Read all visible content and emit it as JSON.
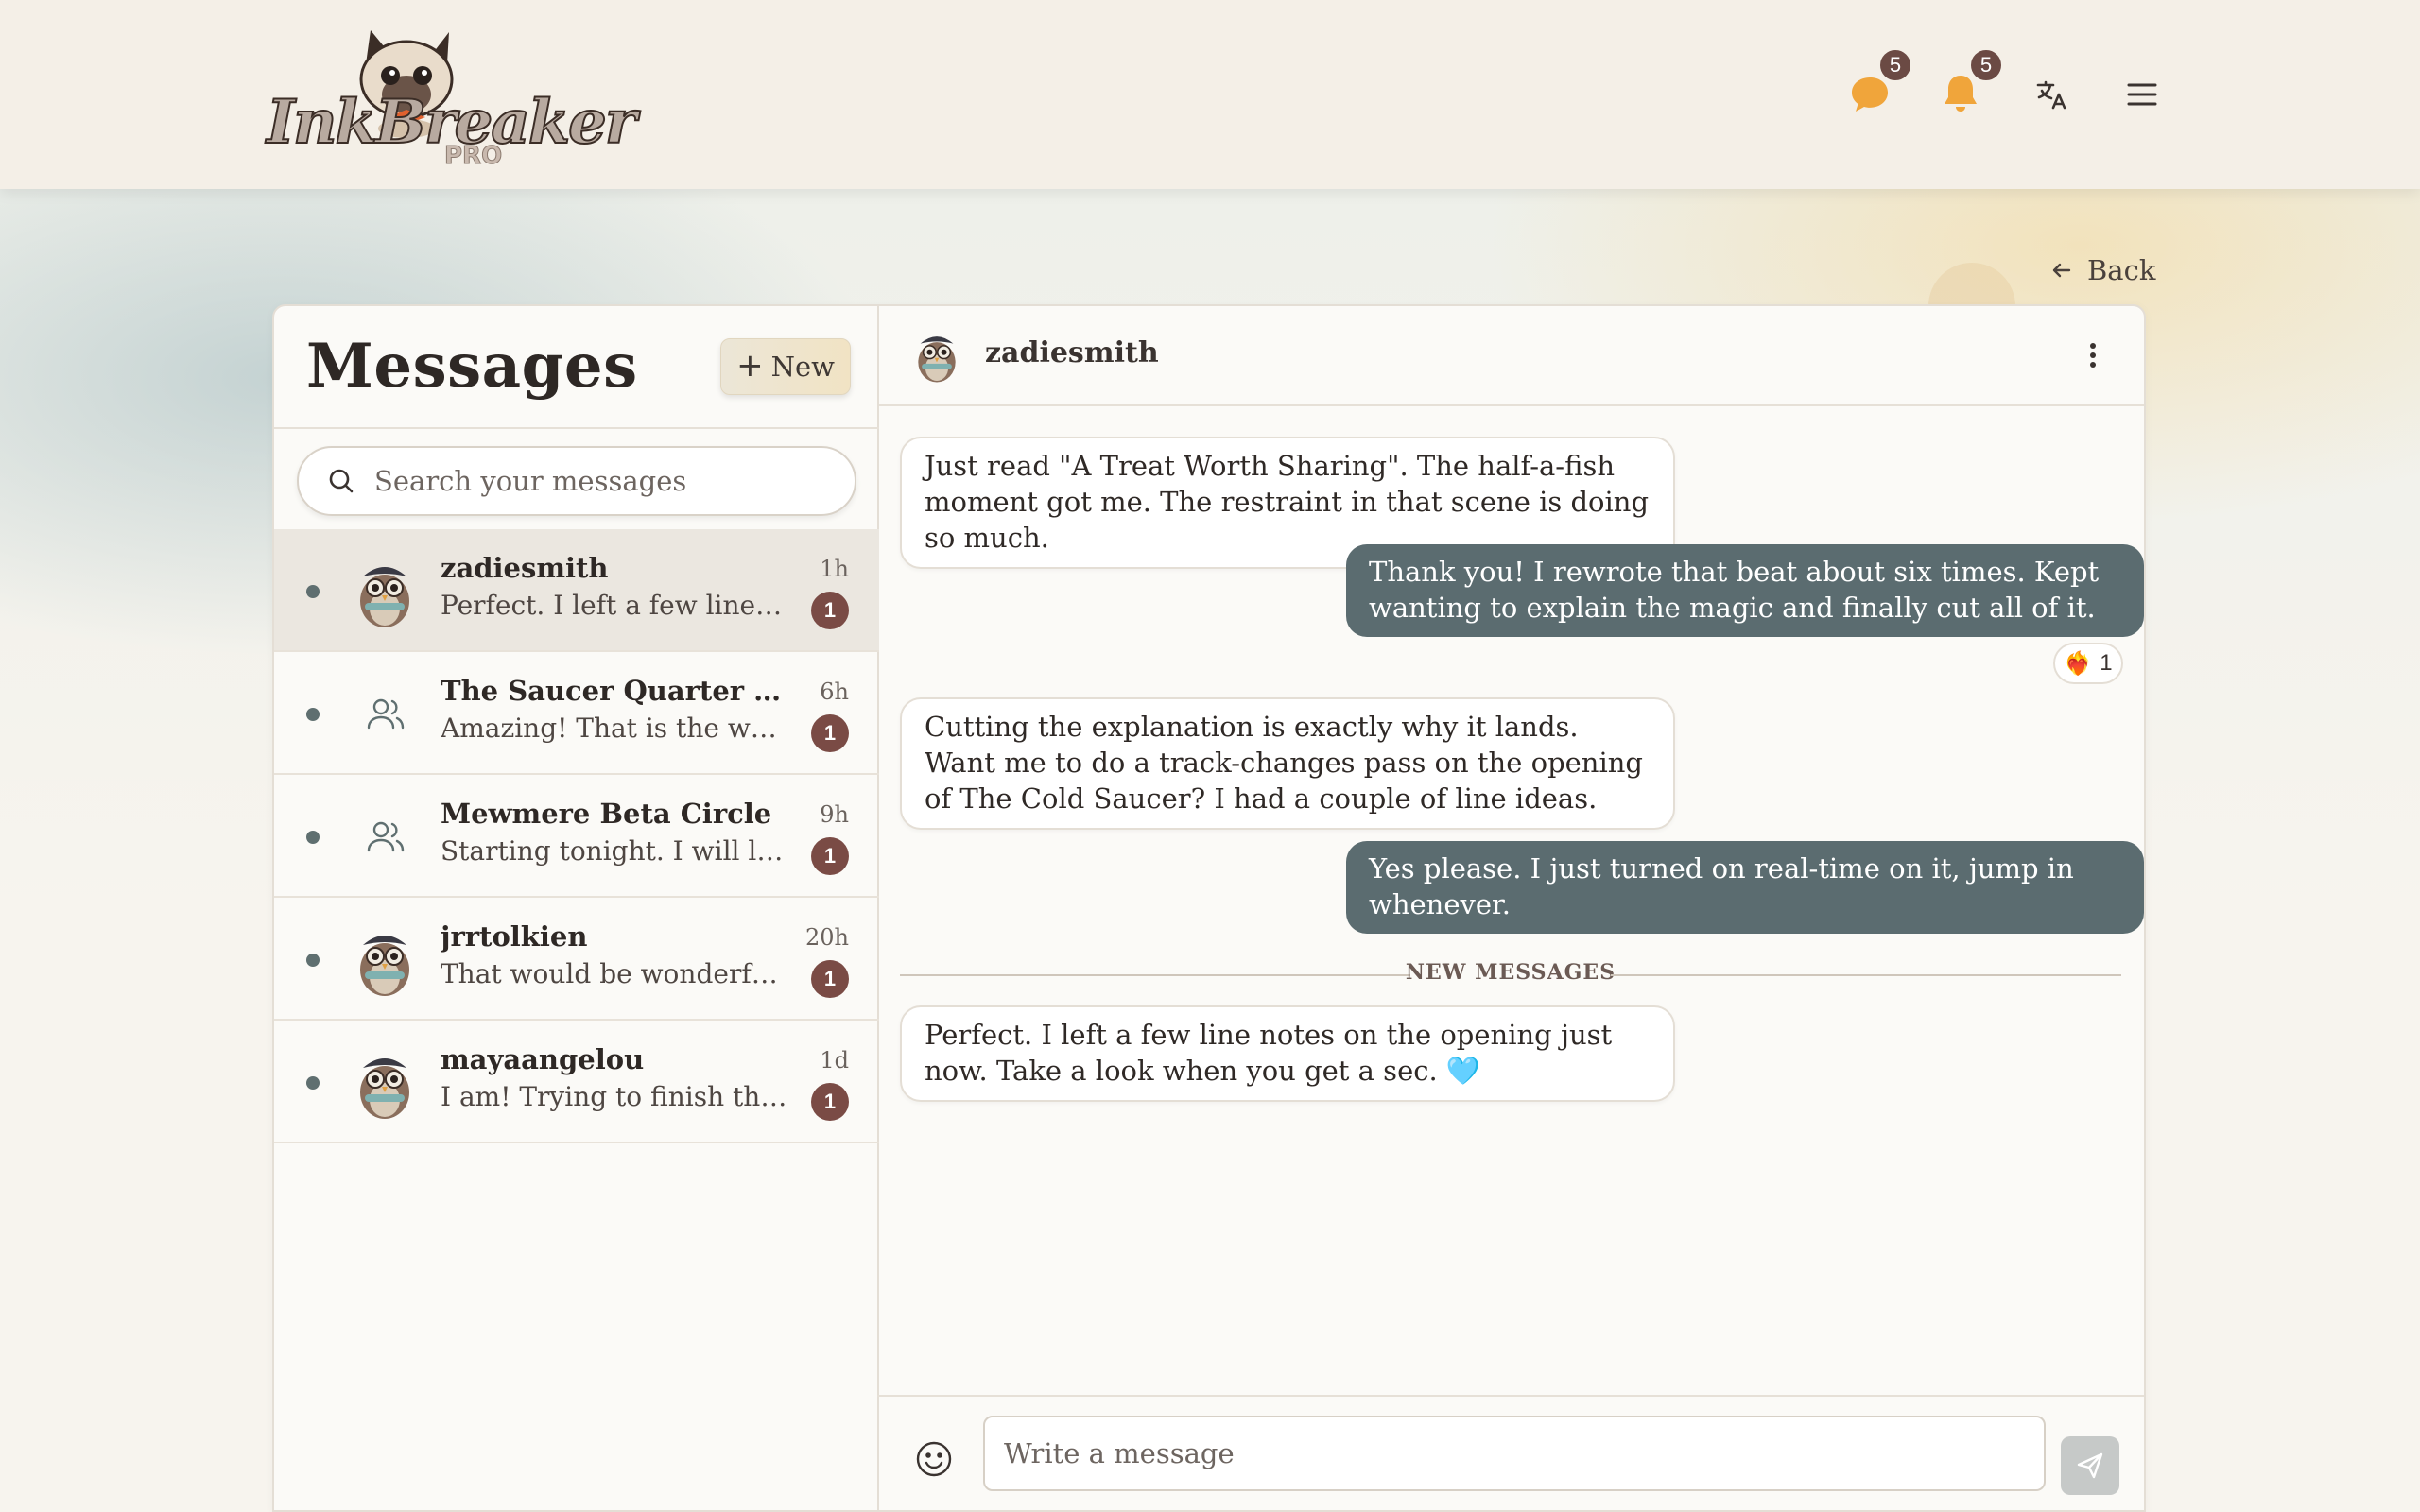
{
  "app": {
    "brand": "InkBreaker",
    "brand_tier": "PRO"
  },
  "header": {
    "messages_badge": "5",
    "notifications_badge": "5",
    "icons": [
      "chat-bubble-icon",
      "bell-icon",
      "translate-icon",
      "menu-icon"
    ]
  },
  "back_label": "Back",
  "sidebar": {
    "title": "Messages",
    "new_label": "New",
    "search_placeholder": "Search your messages",
    "conversations": [
      {
        "name": "zadiesmith",
        "preview": "Perfect. I left a few line not...",
        "time": "1h",
        "unread": "1",
        "kind": "user"
      },
      {
        "name": "The Saucer Quarter Writin...",
        "preview": "Amazing! That is the whol...",
        "time": "6h",
        "unread": "1",
        "kind": "group"
      },
      {
        "name": "Mewmere Beta Circle",
        "preview": "Starting tonight. I will leav...",
        "time": "9h",
        "unread": "1",
        "kind": "group"
      },
      {
        "name": "jrrtolkien",
        "preview": "That would be wonderful, t...",
        "time": "20h",
        "unread": "1",
        "kind": "user"
      },
      {
        "name": "mayaangelou",
        "preview": "I am! Trying to finish the c...",
        "time": "1d",
        "unread": "1",
        "kind": "user"
      }
    ]
  },
  "chat": {
    "username": "zadiesmith",
    "messages": [
      {
        "dir": "in",
        "text": "Just read \"A Treat Worth Sharing\". The half-a-fish moment got me. The restraint in that scene is doing so much."
      },
      {
        "dir": "out",
        "text": "Thank you! I rewrote that beat about six times. Kept wanting to explain the magic and finally cut all of it."
      },
      {
        "dir": "in",
        "text": "Cutting the explanation is exactly why it lands. Want me to do a track-changes pass on the opening of The Cold Saucer? I had a couple of line ideas."
      },
      {
        "dir": "out",
        "text": "Yes please. I just turned on real-time on it, jump in whenever."
      },
      {
        "dir": "in",
        "text": "Perfect. I left a few line notes on the opening just now. Take a look when you get a sec."
      }
    ],
    "reaction": {
      "emoji": "❤️‍🔥",
      "count": "1"
    },
    "new_messages_label": "NEW MESSAGES",
    "heart_emoji": "🩵",
    "composer_placeholder": "Write a message"
  },
  "colors": {
    "accent": "#5b6c70",
    "badge": "#6b4a44",
    "notif_icon": "#f0a53b"
  }
}
